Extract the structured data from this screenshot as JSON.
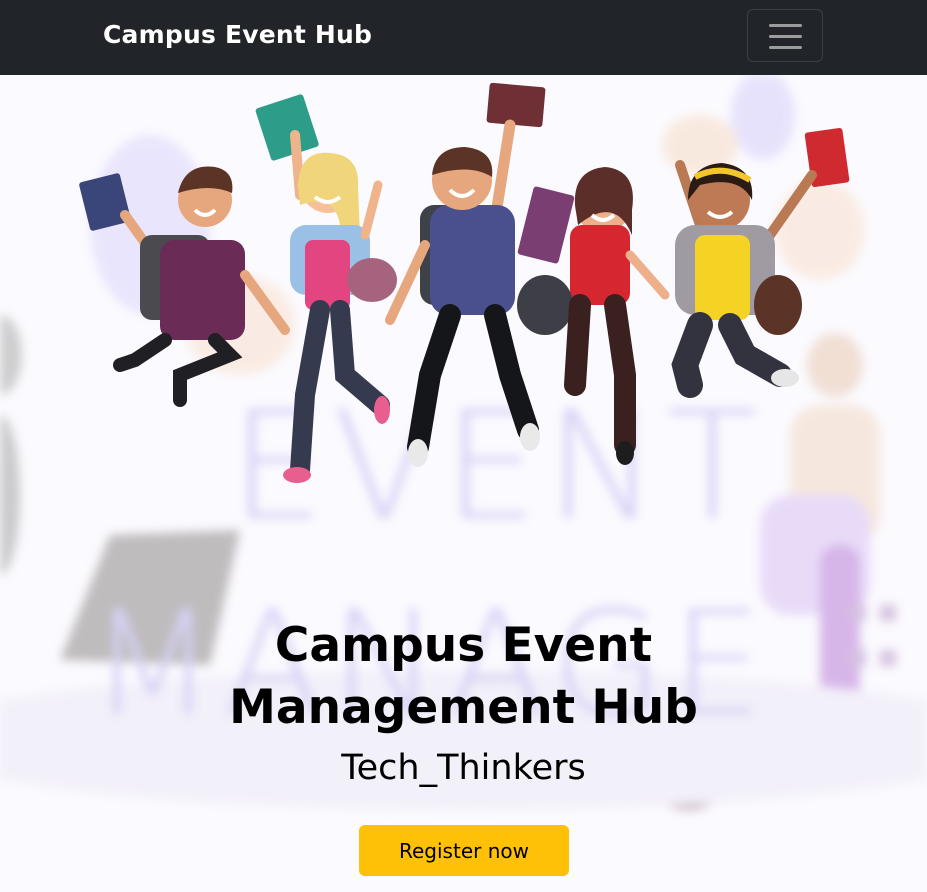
{
  "navbar": {
    "brand": "Campus Event Hub",
    "toggler_icon": "hamburger-menu-icon"
  },
  "hero": {
    "title_line1": "Campus Event",
    "title_line2": "Management Hub",
    "subtitle": "Tech_Thinkers",
    "register_label": "Register now",
    "background_words": [
      "EVENT",
      "MANAGE"
    ],
    "illustration": "five-jumping-students-illustration"
  },
  "colors": {
    "navbar_bg": "#212529",
    "accent": "#ffc107",
    "background_text": "#b9b2f0"
  }
}
